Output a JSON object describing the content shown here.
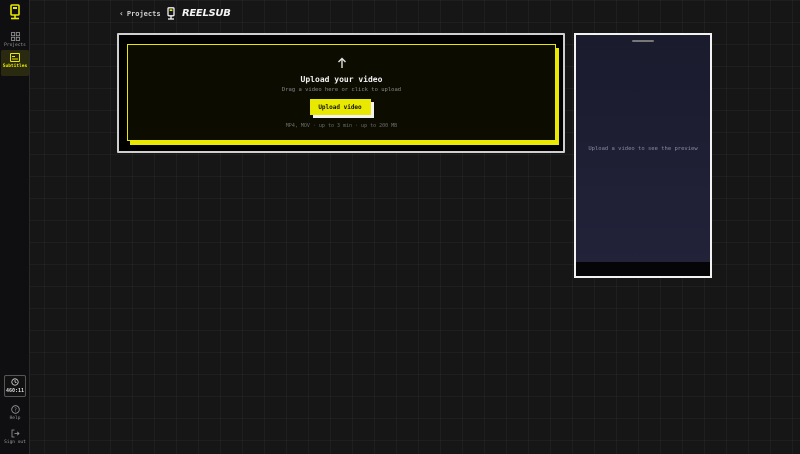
{
  "sidebar": {
    "logo_icon": "reelsub-logo-icon",
    "items": [
      {
        "label": "Projects",
        "icon": "grid-icon",
        "active": false
      },
      {
        "label": "Subtitles",
        "icon": "subtitles-icon",
        "active": true
      }
    ],
    "credits": {
      "icon": "clock-icon",
      "value": "460:11"
    },
    "bottom_items": [
      {
        "label": "Help",
        "icon": "help-icon"
      },
      {
        "label": "Sign out",
        "icon": "sign-out-icon"
      }
    ]
  },
  "header": {
    "back_label": "Projects",
    "brand_name": "REELSUB"
  },
  "upload": {
    "title": "Upload your video",
    "subtitle": "Drag a video here or click to upload",
    "button_label": "Upload video",
    "note": "MP4, MOV · up to 3 min · up to 200 MB"
  },
  "preview": {
    "placeholder": "Upload a video to see the preview"
  },
  "colors": {
    "accent": "#e8e800",
    "background": "#161616",
    "sidebar": "#0f0f12",
    "phone_bg": "#1b1b2e"
  }
}
